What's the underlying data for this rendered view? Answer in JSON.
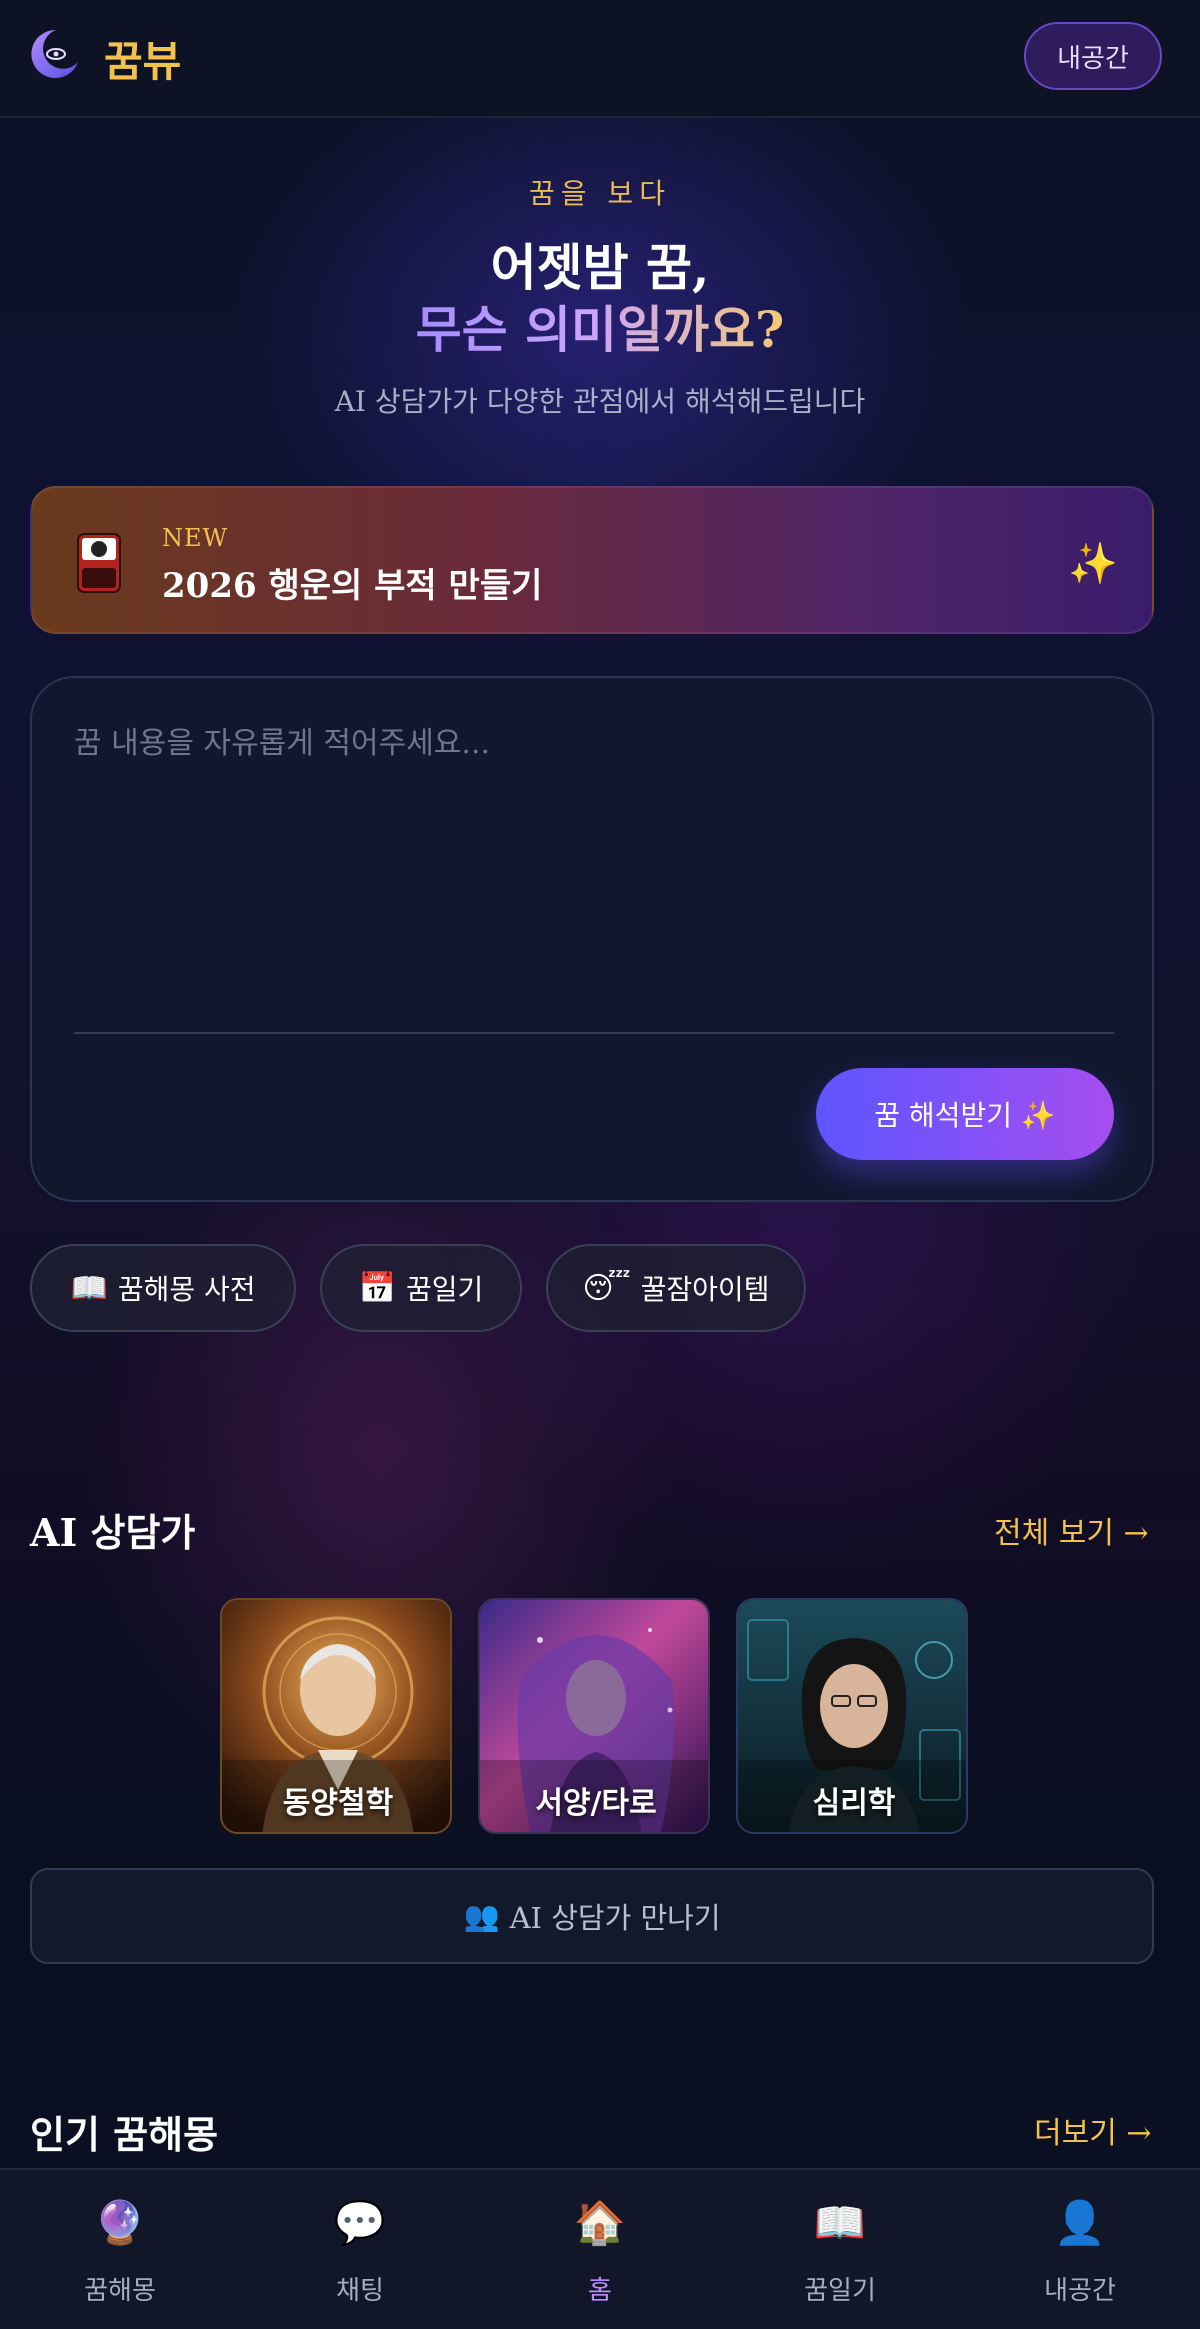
{
  "app": {
    "name": "꿈뷰"
  },
  "header": {
    "my_space_label": "내공간"
  },
  "hero": {
    "kicker": "꿈을 보다",
    "title_line1": "어젯밤 꿈,",
    "title_line2": "무슨 의미일까요?",
    "subtitle": "AI 상담가가 다양한 관점에서 해석해드립니다"
  },
  "banner": {
    "badge": "NEW",
    "title": "2026 행운의 부적 만들기",
    "sparkle": "✨"
  },
  "dream_input": {
    "placeholder": "꿈 내용을 자유롭게 적어주세요...",
    "value": "",
    "submit_label": "꿈 해석받기 ✨"
  },
  "quick_links": [
    {
      "icon": "📖",
      "label": "꿈해몽 사전"
    },
    {
      "icon": "📅",
      "label": "꿈일기"
    },
    {
      "icon": "😴",
      "label": "꿀잠아이템"
    }
  ],
  "counselors_section": {
    "title": "AI 상담가",
    "view_all": "전체 보기 →",
    "items": [
      {
        "label": "동양철학"
      },
      {
        "label": "서양/타로"
      },
      {
        "label": "심리학"
      }
    ],
    "meet_label": "AI 상담가 만나기",
    "meet_icon": "👥"
  },
  "popular_section": {
    "title": "인기 꿈해몽",
    "more": "더보기 →"
  },
  "bottom_nav": [
    {
      "icon": "🔮",
      "label": "꿈해몽",
      "active": false
    },
    {
      "icon": "💬",
      "label": "채팅",
      "active": false
    },
    {
      "icon": "🏠",
      "label": "홈",
      "active": true
    },
    {
      "icon": "📖",
      "label": "꿈일기",
      "active": false
    },
    {
      "icon": "👤",
      "label": "내공간",
      "active": false
    }
  ],
  "colors": {
    "accent_gold": "#f2c14e",
    "accent_purple": "#a54ef0",
    "background": "#0b1020"
  }
}
